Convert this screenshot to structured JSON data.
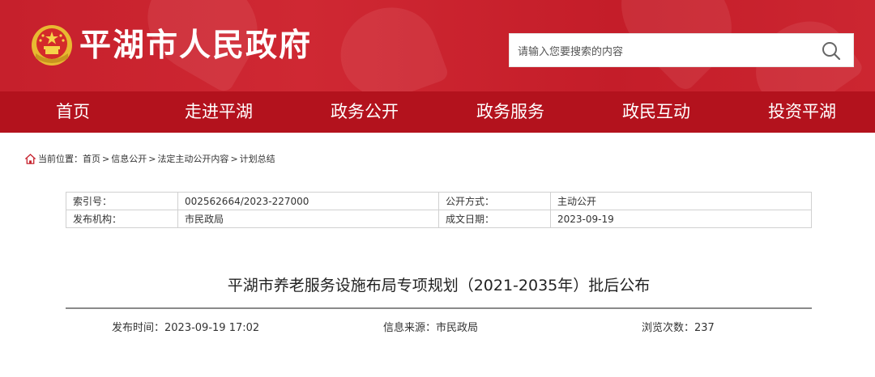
{
  "header": {
    "site_title": "平湖市人民政府",
    "emblem_icon": "national-emblem-icon",
    "brand_color": "#c6202c",
    "nav_color": "#b3121d"
  },
  "search": {
    "placeholder": "请输入您要搜索的内容",
    "icon": "search-icon"
  },
  "nav": {
    "items": [
      "首页",
      "走进平湖",
      "政务公开",
      "政务服务",
      "政民互动",
      "投资平湖"
    ]
  },
  "breadcrumb": {
    "prefix": "当前位置：",
    "items": [
      "首页",
      "信息公开",
      "法定主动公开内容",
      "计划总结"
    ],
    "separator": ">"
  },
  "meta": {
    "rows": [
      {
        "label1": "索引号：",
        "value1": "002562664/2023-227000",
        "label2": "公开方式：",
        "value2": "主动公开"
      },
      {
        "label1": "发布机构：",
        "value1": "市民政局",
        "label2": "成文日期：",
        "value2": "2023-09-19"
      }
    ]
  },
  "article": {
    "title": "平湖市养老服务设施布局专项规划（2021-2035年）批后公布",
    "publish_label": "发布时间：",
    "publish_time": "2023-09-19 17:02",
    "source_label": "信息来源：",
    "source": "市民政局",
    "views_label": "浏览次数：",
    "views": "237"
  }
}
